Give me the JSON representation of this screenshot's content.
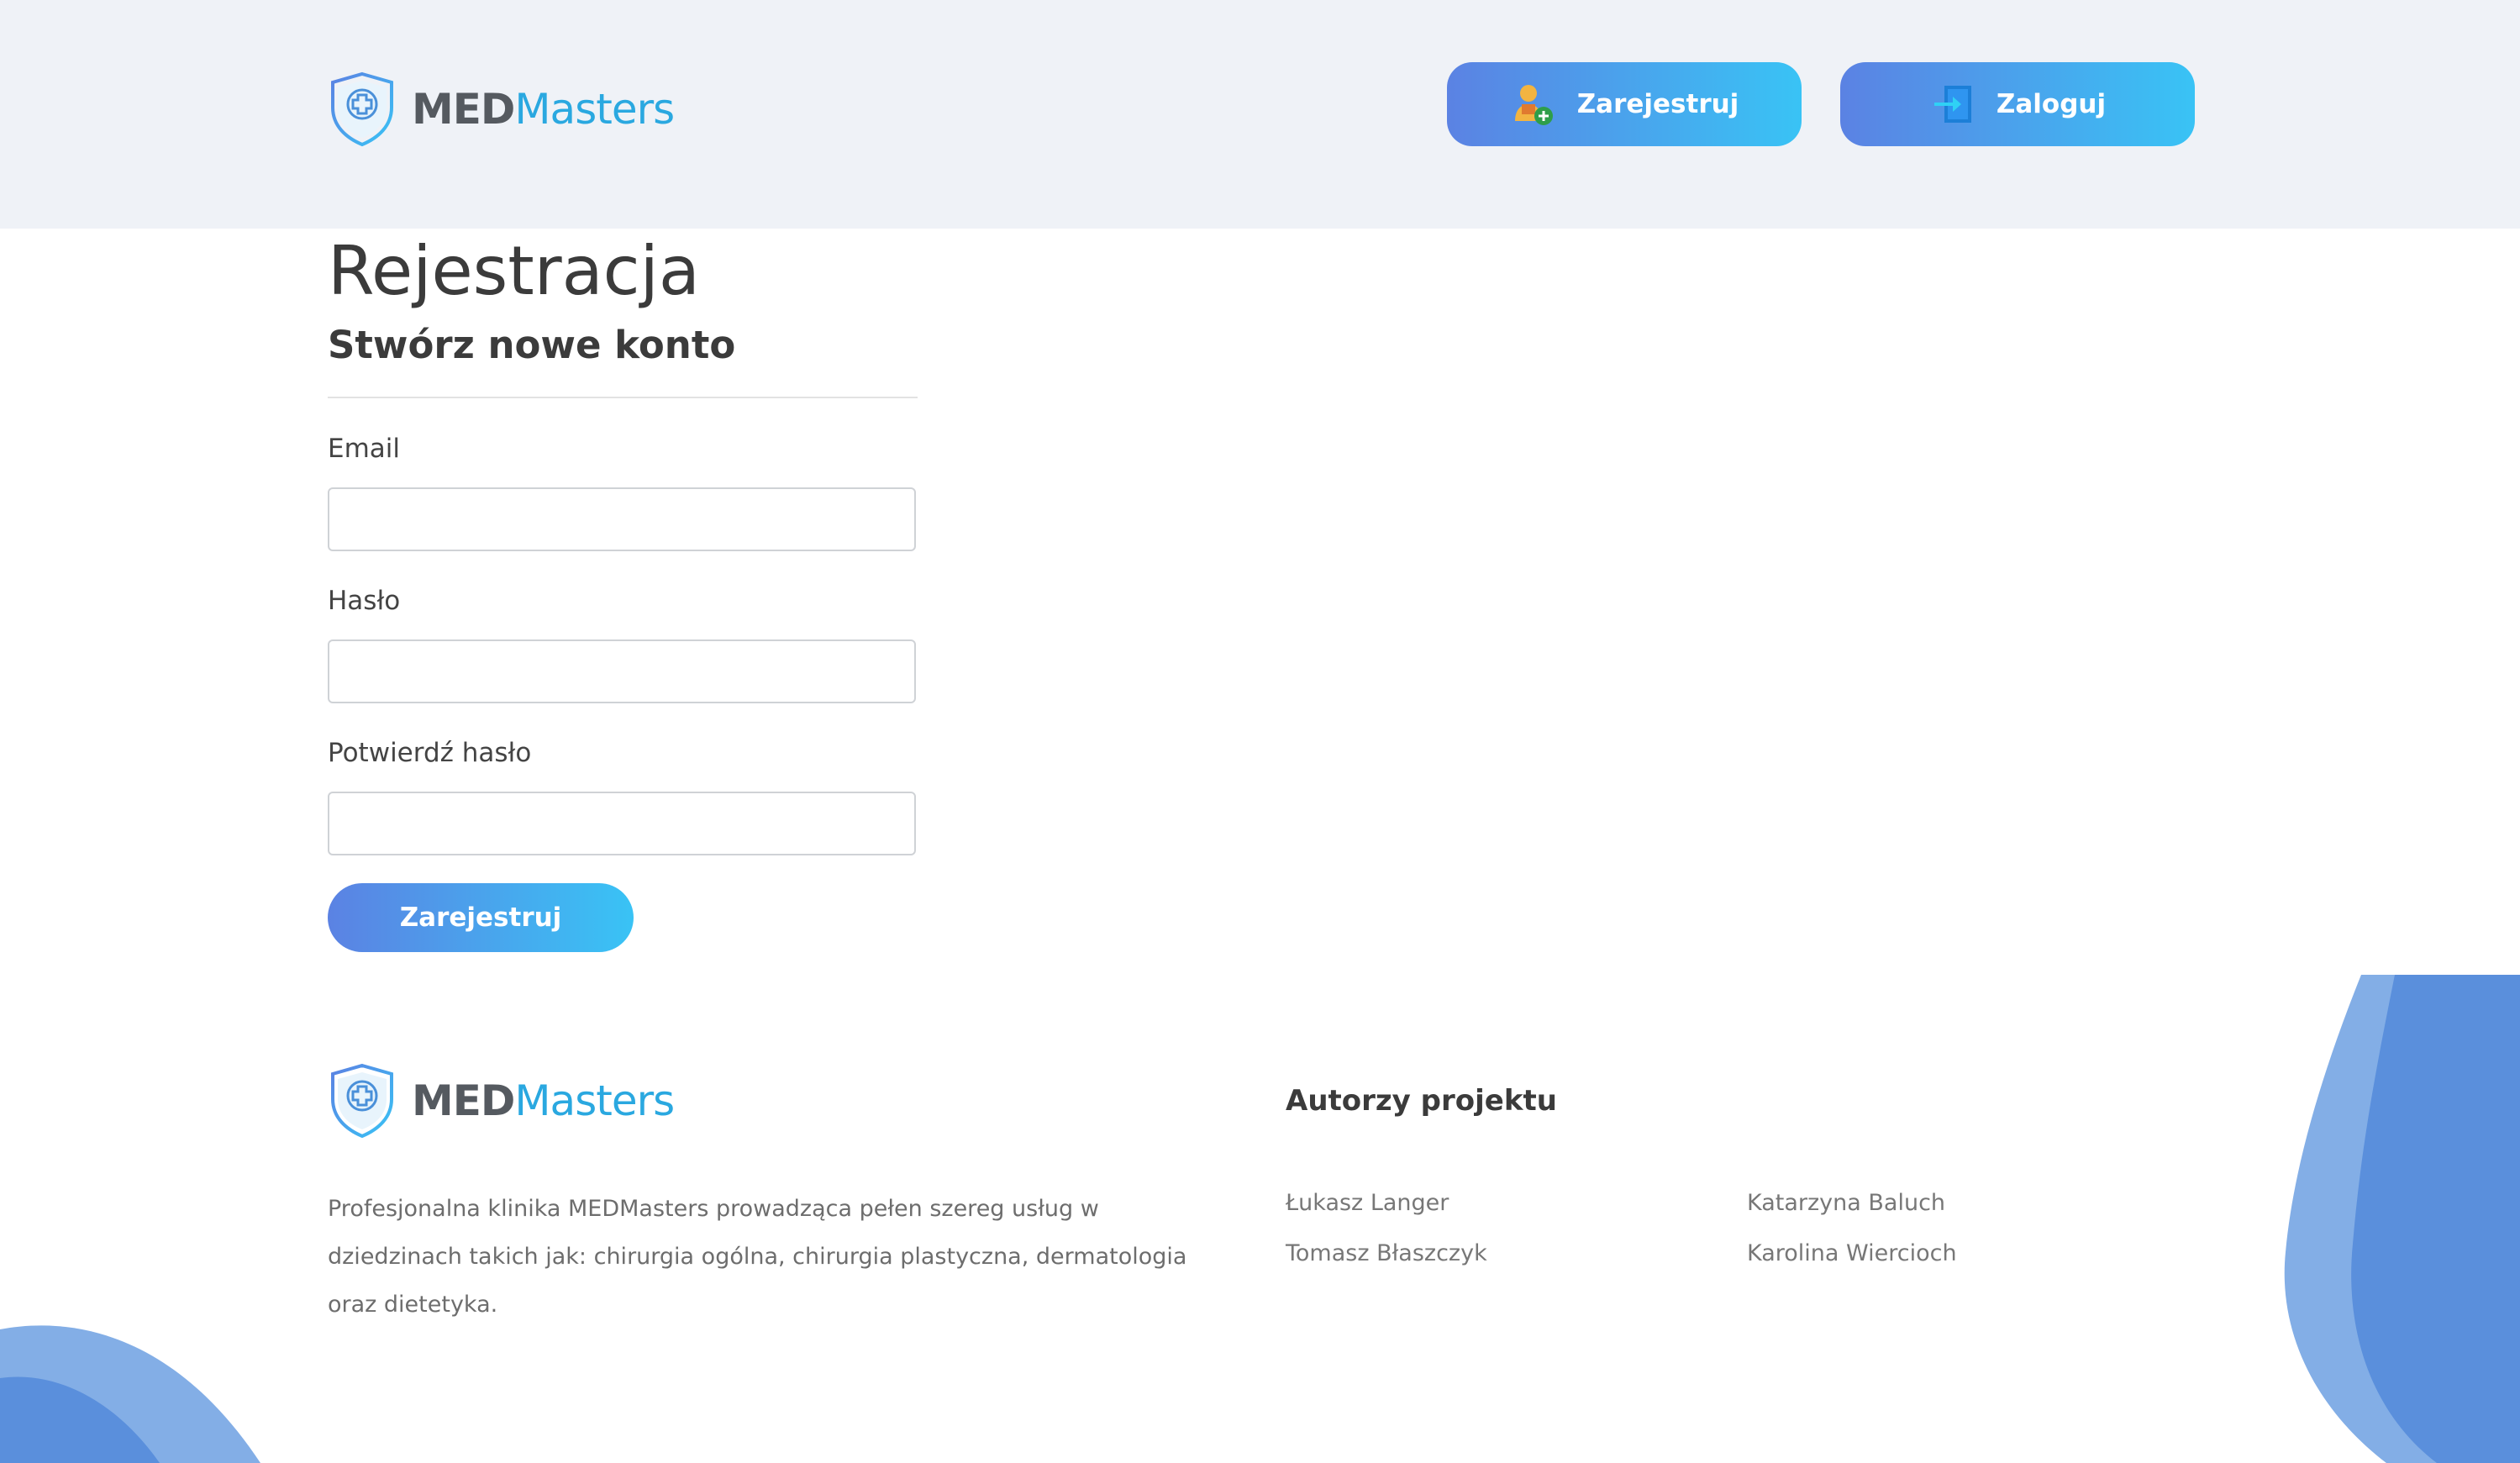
{
  "brand": {
    "name_part1": "MED",
    "name_part2": "Masters"
  },
  "header": {
    "register_label": "Zarejestruj",
    "login_label": "Zaloguj"
  },
  "form": {
    "title": "Rejestracja",
    "subtitle": "Stwórz nowe konto",
    "email_label": "Email",
    "email_value": "",
    "password_label": "Hasło",
    "password_value": "",
    "confirm_label": "Potwierdź hasło",
    "confirm_value": "",
    "submit_label": "Zarejestruj"
  },
  "footer": {
    "description": "Profesjonalna klinika MEDMasters prowadząca pełen szereg usług w dziedzinach takich jak: chirurgia ogólna, chirurgia plastyczna, dermatologia oraz dietetyka.",
    "authors_title": "Autorzy projektu",
    "authors": [
      "Łukasz Langer",
      "Katarzyna Baluch",
      "Tomasz Błaszczyk",
      "Karolina Wiercioch"
    ]
  },
  "colors": {
    "accent_start": "#5b82e3",
    "accent_end": "#39c3f5",
    "header_bg": "#eff2f7",
    "brand_blue": "#2aa8e0"
  }
}
